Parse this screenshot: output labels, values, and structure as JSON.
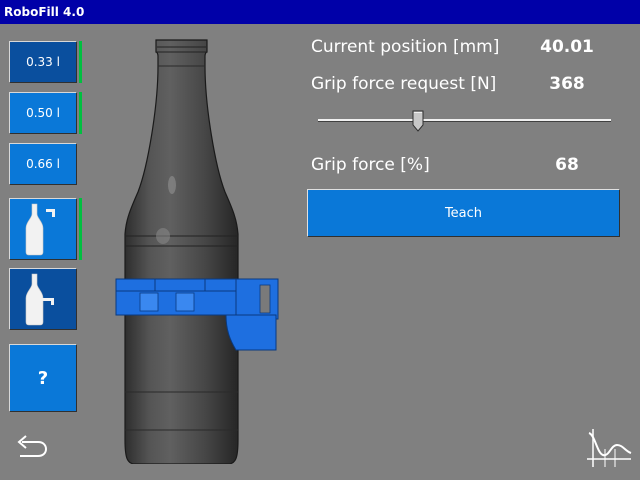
{
  "window": {
    "title": "RoboFill 4.0"
  },
  "sidebar": {
    "buttons": [
      {
        "label": "0.33 l",
        "state": "selected"
      },
      {
        "label": "0.50 l",
        "state": "normal"
      },
      {
        "label": "0.66 l",
        "state": "normal"
      }
    ],
    "mode_buttons": [
      {
        "icon": "bottle-gripper-open-icon",
        "state": "normal"
      },
      {
        "icon": "bottle-gripper-closed-icon",
        "state": "selected"
      }
    ],
    "help_label": "?",
    "active_indicator_color": "#00c040"
  },
  "readouts": {
    "current_position": {
      "label": "Current position [mm]",
      "value": "40.01"
    },
    "grip_force_request": {
      "label": "Grip force request [N]",
      "value": "368"
    },
    "grip_force": {
      "label": "Grip force [%]",
      "value": "68"
    }
  },
  "slider": {
    "value_fraction": 0.34
  },
  "teach_button": {
    "label": "Teach"
  },
  "footer": {
    "back_icon": "back-arrow-icon",
    "curve_icon": "force-curve-icon"
  },
  "colors": {
    "background": "#808080",
    "titlebar": "#0000a8",
    "button": "#0a78d8",
    "button_selected": "#0a4f9e",
    "gripper": "#1e6fe0"
  }
}
